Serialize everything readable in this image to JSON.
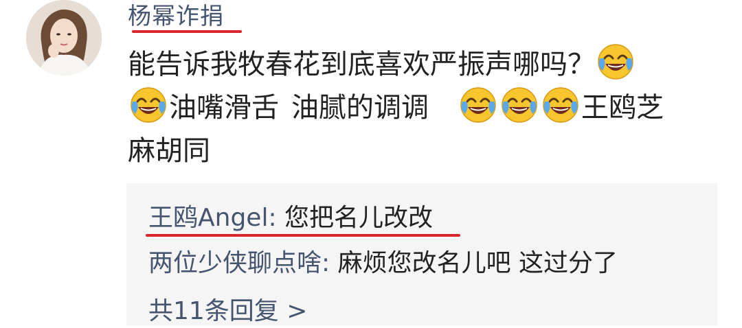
{
  "comment": {
    "author": "杨幂诈捐",
    "line1_text": "能告诉我牧春花到底喜欢严振声哪吗？",
    "line2_part1": "油嘴滑舌",
    "line2_part2": "油腻的调调",
    "line2_part3": "王鸥芝",
    "line3_text": "麻胡同",
    "emoji": "laughing-crying-emoji"
  },
  "replies": [
    {
      "name": "王鸥Angel",
      "separator": ": ",
      "text": "您把名儿改改"
    },
    {
      "name": "两位少侠聊点啥",
      "separator": ": ",
      "text": "麻烦您改名儿吧 这过分了"
    }
  ],
  "more_replies_label": "共11条回复 >",
  "colors": {
    "username": "#45556f",
    "underline": "#d8262b",
    "reply_bg": "#f5f5f5",
    "emoji_face": "#f7c62f",
    "emoji_tears": "#5aa8e8"
  }
}
